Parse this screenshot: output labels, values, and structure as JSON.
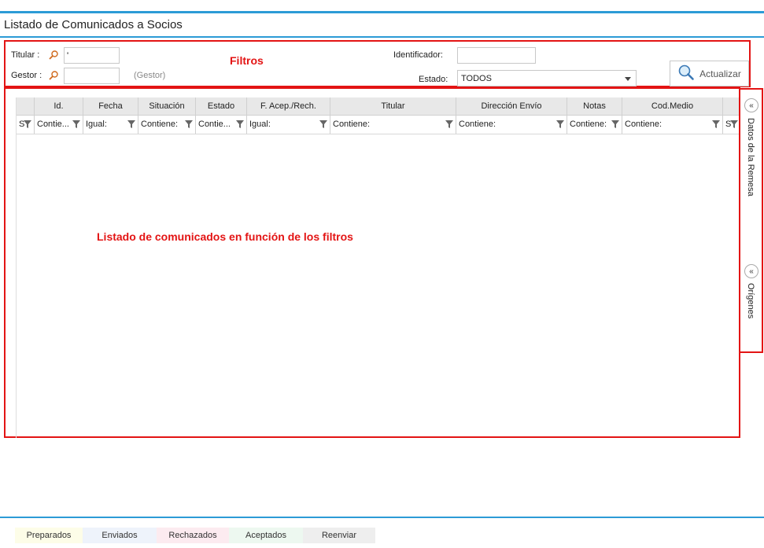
{
  "page": {
    "title": "Listado de Comunicados a Socios"
  },
  "filters": {
    "annotation": "Filtros",
    "titular_label": "Titular :",
    "titular_value": "'",
    "gestor_label": "Gestor :",
    "gestor_value": "",
    "gestor_hint": "(Gestor)",
    "identificador_label": "Identificador:",
    "identificador_value": "",
    "estado_label": "Estado:",
    "estado_value": "TODOS",
    "refresh_label": "Actualizar"
  },
  "grid": {
    "annotation": "Listado de comunicados en función de los filtros",
    "columns": [
      {
        "header": "",
        "filter": "S"
      },
      {
        "header": "Id.",
        "filter": "Contie..."
      },
      {
        "header": "Fecha",
        "filter": "Igual:"
      },
      {
        "header": "Situación",
        "filter": "Contiene:"
      },
      {
        "header": "Estado",
        "filter": "Contie..."
      },
      {
        "header": "F. Acep./Rech.",
        "filter": "Igual:"
      },
      {
        "header": "Titular",
        "filter": "Contiene:"
      },
      {
        "header": "Dirección Envío",
        "filter": "Contiene:"
      },
      {
        "header": "Notas",
        "filter": "Contiene:"
      },
      {
        "header": "Cod.Medio",
        "filter": "Contiene:"
      },
      {
        "header": "",
        "filter": "S"
      }
    ]
  },
  "sidepanel": {
    "datos_label": "Datos de la Remesa",
    "origenes_label": "Orígenes",
    "collapse_glyph": "«"
  },
  "legend": {
    "items": [
      {
        "label": "Preparados",
        "color": "#fdfde8"
      },
      {
        "label": "Enviados",
        "color": "#eef3fb"
      },
      {
        "label": "Rechazados",
        "color": "#fcebf0"
      },
      {
        "label": "Aceptados",
        "color": "#edf8f0"
      },
      {
        "label": "Reenviar",
        "color": "#eeeeee"
      }
    ]
  },
  "colors": {
    "accent": "#2c9bd6",
    "annotation_red": "#e31414"
  }
}
